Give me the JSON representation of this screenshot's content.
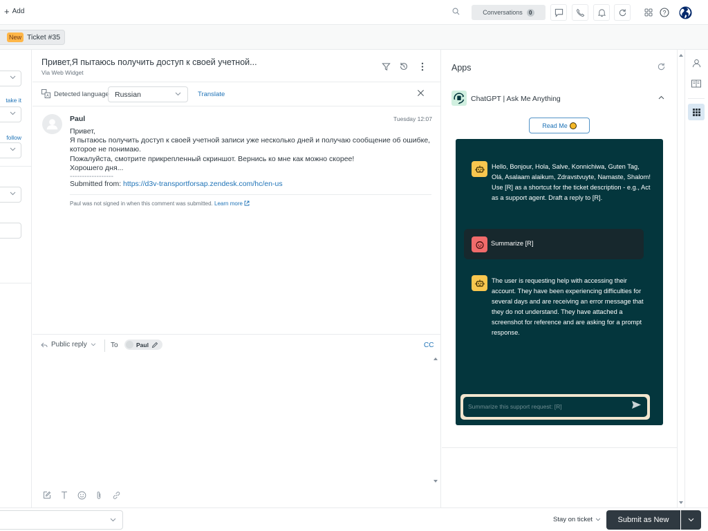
{
  "topbar": {
    "add_label": "Add",
    "conversations_label": "Conversations",
    "conversations_count": "0",
    "icons": [
      "search-icon",
      "chat-icon",
      "phone-icon",
      "bell-icon",
      "refresh-icon",
      "apps-grid-icon",
      "help-icon",
      "globe-icon"
    ]
  },
  "tabs": [
    {
      "badge": "New",
      "label": "Ticket #35"
    }
  ],
  "left_panel": {
    "link_take_it": "take it",
    "link_follow": "follow"
  },
  "conversation": {
    "subject": "Привет,Я пытаюсь получить доступ к своей учетной...",
    "channel": "Via Web Widget",
    "detected_language_label": "Detected language",
    "language_value": "Russian",
    "translate_label": "Translate",
    "message": {
      "author": "Paul",
      "time": "Tuesday 12:07",
      "lines": [
        "Привет,",
        "Я пытаюсь получить доступ к своей учетной записи уже несколько дней и получаю сообщение об ошибке,",
        "которое не понимаю.",
        "Пожалуйста, смотрите прикрепленный скриншот. Вернись ко мне как можно скорее!",
        "Хорошего дня...",
        "------------------"
      ],
      "submitted_from_label": "Submitted from:",
      "submitted_from_url": "https://d3v-transportforsap.zendesk.com/hc/en-us",
      "note": "Paul was not signed in when this comment was submitted.",
      "learn_more": "Learn more"
    }
  },
  "composer": {
    "reply_type": "Public reply",
    "to_label": "To",
    "recipient": "Paul",
    "cc_label": "CC",
    "tools": [
      "compose-icon",
      "text-format-icon",
      "emoji-icon",
      "attachment-icon",
      "link-icon"
    ]
  },
  "apps": {
    "title": "Apps",
    "app_name": "ChatGPT | Ask Me Anything",
    "readme_label": "Read Me",
    "chat": {
      "messages": [
        {
          "role": "bot",
          "text": "Hello, Bonjour, Hola, Salve, Konnichiwa, Guten Tag, Olá, Asalaam alaikum, Zdravstvuyte, Namaste, Shalom! Use [R] as a shortcut for the ticket description - e.g., Act as a support agent. Draft a reply to [R]."
        },
        {
          "role": "user",
          "text": "Summarize [R]"
        },
        {
          "role": "bot",
          "text": "The user is requesting help with accessing their account. They have been experiencing difficulties for several days and are receiving an error message that they do not understand. They have attached a screenshot for reference and are asking for a prompt response."
        }
      ],
      "input_placeholder": "Summarize this support request: [R]",
      "colors": {
        "background": "#04363d",
        "bot_avatar": "#f9c74f",
        "user_avatar": "#f06b6b",
        "input_frame": "#f2e6cf"
      }
    }
  },
  "footer": {
    "stay_label": "Stay on ticket",
    "submit_label": "Submit as New"
  },
  "colors": {
    "new_badge": "#ffb648",
    "link": "#1f73b7",
    "submit_button": "#2f3941"
  }
}
